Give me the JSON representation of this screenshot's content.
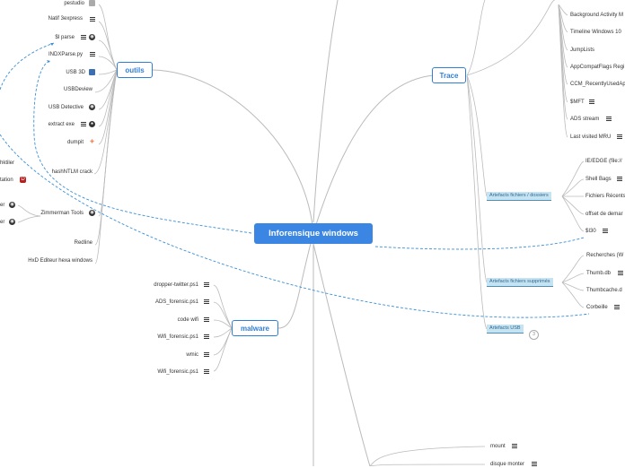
{
  "central": {
    "label": "Inforensique windows"
  },
  "outils": {
    "label": "outils",
    "items": [
      "pestudio",
      "Natif 3express",
      "$I parse",
      "INDXParse.py",
      "USB 3D",
      "USBDeview",
      "USB Detective",
      "extract exe",
      "dumpit",
      "hashNTLM crack",
      "Zimmerman Tools",
      "Redline",
      "HxD Editeur hexa windows"
    ],
    "partial": [
      "hktiler",
      "tation",
      "er",
      "er"
    ]
  },
  "trace": {
    "label": "Trace",
    "items": [
      "Background Activity M",
      "Timeline Windows 10",
      "JumpLists",
      "AppCompatFlags Regi",
      "CCM_RecentlyUsedAp",
      "$MFT",
      "ADS stream",
      "Last visited MRU"
    ],
    "subs": [
      "Artefacts fichiers / dossiers",
      "Artefacts fichiers supprimés",
      "Artefacts USB"
    ],
    "fichiers_items": [
      "IE/EDGE (file://",
      "Shell Bags",
      "Fichiers Récents",
      "offset de demar",
      "$I30"
    ],
    "supprimes_items": [
      "Recherches (W",
      "Thumb.db",
      "Thumbcache.d",
      "Corbeille"
    ],
    "usb_badge": "3"
  },
  "malware": {
    "label": "malware",
    "items": [
      "dropper-twitter.ps1",
      "ADS_forensic.ps1",
      "code wifi",
      "Wifi_forensic.ps1",
      "wmic",
      "Wifi_forensic.ps1"
    ]
  },
  "bottom": {
    "items": [
      "mount",
      "disque monter"
    ]
  },
  "colors": {
    "accent": "#2f7fd8",
    "central_bg": "#3b86e2",
    "sub_bg": "#c8e3f0",
    "branch": "#bbbbbb",
    "link": "#3a8fd8"
  }
}
